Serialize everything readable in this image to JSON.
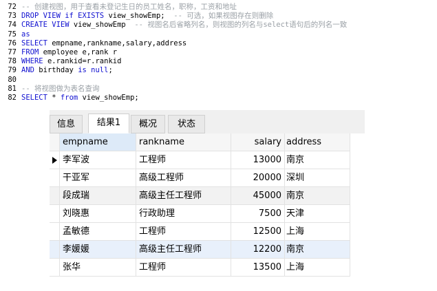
{
  "editor": {
    "lines": [
      {
        "no": "72",
        "parts": [
          {
            "t": "-- 创建视图，用于查看未登记生日的员工姓名，职称，工资和地址",
            "c": "cm"
          }
        ]
      },
      {
        "no": "73",
        "parts": [
          {
            "t": "DROP VIEW if EXISTS ",
            "c": "kw"
          },
          {
            "t": "view_showEmp;",
            "c": "id"
          },
          {
            "t": "  -- 可选，如果视图存在则删除",
            "c": "cm"
          }
        ]
      },
      {
        "no": "74",
        "parts": [
          {
            "t": "CREATE VIEW ",
            "c": "kw"
          },
          {
            "t": "view_showEmp",
            "c": "id"
          },
          {
            "t": "  -- 视图名后省略列名，则视图的列名与select语句后的列名一致",
            "c": "cm"
          }
        ]
      },
      {
        "no": "75",
        "parts": [
          {
            "t": "as",
            "c": "kw"
          }
        ]
      },
      {
        "no": "76",
        "parts": [
          {
            "t": "SELECT ",
            "c": "kw"
          },
          {
            "t": "empname,rankname,salary,address",
            "c": "id"
          }
        ]
      },
      {
        "no": "77",
        "parts": [
          {
            "t": "FROM ",
            "c": "kw"
          },
          {
            "t": "employee e,rank r",
            "c": "id"
          }
        ]
      },
      {
        "no": "78",
        "parts": [
          {
            "t": "WHERE ",
            "c": "kw"
          },
          {
            "t": "e.rankid=r.rankid",
            "c": "id"
          }
        ]
      },
      {
        "no": "79",
        "parts": [
          {
            "t": "AND ",
            "c": "kw"
          },
          {
            "t": "birthday ",
            "c": "id"
          },
          {
            "t": "is null",
            "c": "kw"
          },
          {
            "t": ";",
            "c": "id"
          }
        ]
      },
      {
        "no": "80",
        "parts": []
      },
      {
        "no": "81",
        "parts": [
          {
            "t": "-- 将视图做为表名查询",
            "c": "cm"
          }
        ]
      },
      {
        "no": "82",
        "parts": [
          {
            "t": "SELECT ",
            "c": "kw"
          },
          {
            "t": "* ",
            "c": "id"
          },
          {
            "t": "from ",
            "c": "kw"
          },
          {
            "t": "view_showEmp;",
            "c": "id"
          }
        ]
      }
    ]
  },
  "result_panel": {
    "tabs": [
      {
        "label": "信息",
        "active": false
      },
      {
        "label": "结果1",
        "active": true
      },
      {
        "label": "概况",
        "active": false
      },
      {
        "label": "状态",
        "active": false
      }
    ],
    "columns": [
      "empname",
      "rankname",
      "salary",
      "address"
    ],
    "rows": [
      [
        "李军波",
        "工程师",
        "13000",
        "南京"
      ],
      [
        "干亚军",
        "高级工程师",
        "20000",
        "深圳"
      ],
      [
        "段成瑞",
        "高级主任工程师",
        "45000",
        "南京"
      ],
      [
        "刘晓惠",
        "行政助理",
        "7500",
        "天津"
      ],
      [
        "孟敏德",
        "工程师",
        "12500",
        "上海"
      ],
      [
        "李媛媛",
        "高级主任工程师",
        "12200",
        "南京"
      ],
      [
        "张华",
        "工程师",
        "13500",
        "上海"
      ]
    ],
    "current_row": 0
  }
}
